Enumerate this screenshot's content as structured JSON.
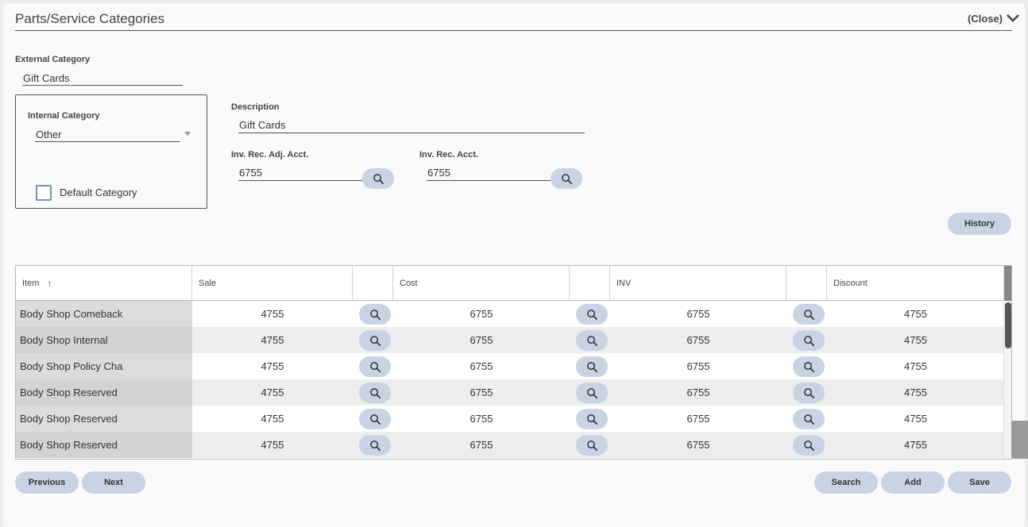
{
  "panel": {
    "title": "Parts/Service Categories",
    "close_label": "(Close)"
  },
  "form": {
    "external_category": {
      "label": "External Category",
      "value": "Gift Cards"
    },
    "internal_category": {
      "label": "Internal Category",
      "value": "Other"
    },
    "default_category": {
      "label": "Default Category",
      "checked": false
    },
    "description": {
      "label": "Description",
      "value": "Gift Cards"
    },
    "inv_rec_adj_acct": {
      "label": "Inv. Rec. Adj. Acct.",
      "value": "6755"
    },
    "inv_rec_acct": {
      "label": "Inv. Rec. Acct.",
      "value": "6755"
    }
  },
  "buttons": {
    "history": "History",
    "previous": "Previous",
    "next": "Next",
    "search": "Search",
    "add": "Add",
    "save": "Save"
  },
  "grid": {
    "headers": {
      "item": "Item",
      "sale": "Sale",
      "cost": "Cost",
      "inv": "INV",
      "discount": "Discount"
    },
    "sort_indicator": "↑",
    "rows": [
      {
        "item": "Body Shop Comeback",
        "sale": "4755",
        "cost": "6755",
        "inv": "6755",
        "discount": "4755"
      },
      {
        "item": "Body Shop Internal",
        "sale": "4755",
        "cost": "6755",
        "inv": "6755",
        "discount": "4755"
      },
      {
        "item": "Body Shop Policy Cha",
        "sale": "4755",
        "cost": "6755",
        "inv": "6755",
        "discount": "4755"
      },
      {
        "item": "Body Shop Reserved",
        "sale": "4755",
        "cost": "6755",
        "inv": "6755",
        "discount": "4755"
      },
      {
        "item": "Body Shop Reserved",
        "sale": "4755",
        "cost": "6755",
        "inv": "6755",
        "discount": "4755"
      },
      {
        "item": "Body Shop Reserved",
        "sale": "4755",
        "cost": "6755",
        "inv": "6755",
        "discount": "4755"
      }
    ]
  },
  "icons": {
    "search": "search-icon",
    "chevron": "chevron-down-icon",
    "dropdown": "caret-down-icon",
    "sort": "sort-up-icon"
  },
  "colors": {
    "button_bg": "#c9d3e3",
    "checkbox_border": "#7c8fb3",
    "row_alt": "#ededed",
    "item_cell": "#dcdcdc"
  }
}
